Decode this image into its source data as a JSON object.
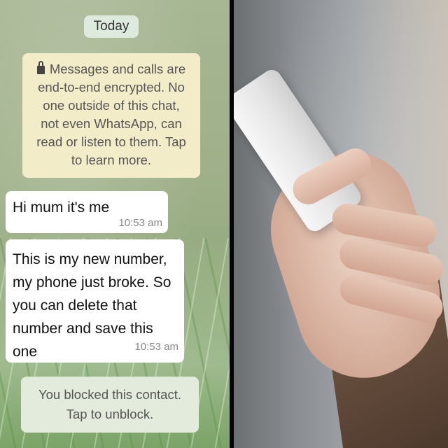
{
  "chat": {
    "date_label": "Today",
    "encryption_notice": "Messages and calls are end-to-end encrypted. No one outside of this chat, not even WhatsApp, can read or listen to them. Tap to learn more.",
    "messages": [
      {
        "text": "Hi mum it's me",
        "time": "10:53 am"
      },
      {
        "text": "This is my new number, my phone just broke. So you can delete that number and save this one",
        "time": "10:53 am"
      }
    ],
    "blocked_notice": "You blocked this contact. Tap to unblock.",
    "icons": {
      "encryption": "lock-icon"
    },
    "colors": {
      "bubble": "#ffffff",
      "system_notice": "#f3ecc8",
      "wallpaper": "#9fb089"
    }
  }
}
